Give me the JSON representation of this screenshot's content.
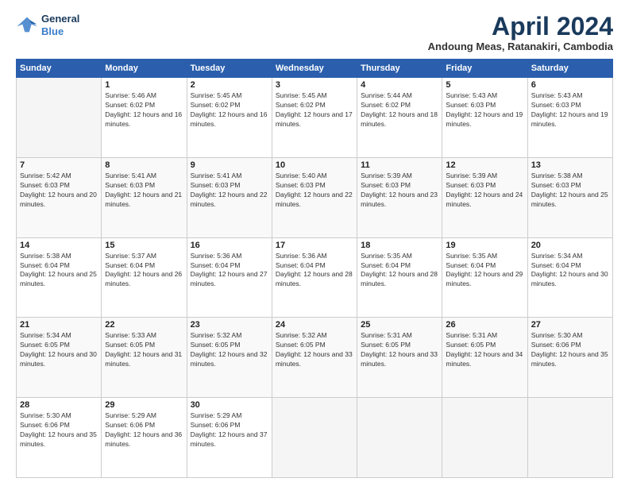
{
  "logo": {
    "line1": "General",
    "line2": "Blue"
  },
  "title": "April 2024",
  "subtitle": "Andoung Meas, Ratanakiri, Cambodia",
  "days_of_week": [
    "Sunday",
    "Monday",
    "Tuesday",
    "Wednesday",
    "Thursday",
    "Friday",
    "Saturday"
  ],
  "weeks": [
    [
      {
        "day": "",
        "sunrise": "",
        "sunset": "",
        "daylight": ""
      },
      {
        "day": "1",
        "sunrise": "Sunrise: 5:46 AM",
        "sunset": "Sunset: 6:02 PM",
        "daylight": "Daylight: 12 hours and 16 minutes."
      },
      {
        "day": "2",
        "sunrise": "Sunrise: 5:45 AM",
        "sunset": "Sunset: 6:02 PM",
        "daylight": "Daylight: 12 hours and 16 minutes."
      },
      {
        "day": "3",
        "sunrise": "Sunrise: 5:45 AM",
        "sunset": "Sunset: 6:02 PM",
        "daylight": "Daylight: 12 hours and 17 minutes."
      },
      {
        "day": "4",
        "sunrise": "Sunrise: 5:44 AM",
        "sunset": "Sunset: 6:02 PM",
        "daylight": "Daylight: 12 hours and 18 minutes."
      },
      {
        "day": "5",
        "sunrise": "Sunrise: 5:43 AM",
        "sunset": "Sunset: 6:03 PM",
        "daylight": "Daylight: 12 hours and 19 minutes."
      },
      {
        "day": "6",
        "sunrise": "Sunrise: 5:43 AM",
        "sunset": "Sunset: 6:03 PM",
        "daylight": "Daylight: 12 hours and 19 minutes."
      }
    ],
    [
      {
        "day": "7",
        "sunrise": "Sunrise: 5:42 AM",
        "sunset": "Sunset: 6:03 PM",
        "daylight": "Daylight: 12 hours and 20 minutes."
      },
      {
        "day": "8",
        "sunrise": "Sunrise: 5:41 AM",
        "sunset": "Sunset: 6:03 PM",
        "daylight": "Daylight: 12 hours and 21 minutes."
      },
      {
        "day": "9",
        "sunrise": "Sunrise: 5:41 AM",
        "sunset": "Sunset: 6:03 PM",
        "daylight": "Daylight: 12 hours and 22 minutes."
      },
      {
        "day": "10",
        "sunrise": "Sunrise: 5:40 AM",
        "sunset": "Sunset: 6:03 PM",
        "daylight": "Daylight: 12 hours and 22 minutes."
      },
      {
        "day": "11",
        "sunrise": "Sunrise: 5:39 AM",
        "sunset": "Sunset: 6:03 PM",
        "daylight": "Daylight: 12 hours and 23 minutes."
      },
      {
        "day": "12",
        "sunrise": "Sunrise: 5:39 AM",
        "sunset": "Sunset: 6:03 PM",
        "daylight": "Daylight: 12 hours and 24 minutes."
      },
      {
        "day": "13",
        "sunrise": "Sunrise: 5:38 AM",
        "sunset": "Sunset: 6:03 PM",
        "daylight": "Daylight: 12 hours and 25 minutes."
      }
    ],
    [
      {
        "day": "14",
        "sunrise": "Sunrise: 5:38 AM",
        "sunset": "Sunset: 6:04 PM",
        "daylight": "Daylight: 12 hours and 25 minutes."
      },
      {
        "day": "15",
        "sunrise": "Sunrise: 5:37 AM",
        "sunset": "Sunset: 6:04 PM",
        "daylight": "Daylight: 12 hours and 26 minutes."
      },
      {
        "day": "16",
        "sunrise": "Sunrise: 5:36 AM",
        "sunset": "Sunset: 6:04 PM",
        "daylight": "Daylight: 12 hours and 27 minutes."
      },
      {
        "day": "17",
        "sunrise": "Sunrise: 5:36 AM",
        "sunset": "Sunset: 6:04 PM",
        "daylight": "Daylight: 12 hours and 28 minutes."
      },
      {
        "day": "18",
        "sunrise": "Sunrise: 5:35 AM",
        "sunset": "Sunset: 6:04 PM",
        "daylight": "Daylight: 12 hours and 28 minutes."
      },
      {
        "day": "19",
        "sunrise": "Sunrise: 5:35 AM",
        "sunset": "Sunset: 6:04 PM",
        "daylight": "Daylight: 12 hours and 29 minutes."
      },
      {
        "day": "20",
        "sunrise": "Sunrise: 5:34 AM",
        "sunset": "Sunset: 6:04 PM",
        "daylight": "Daylight: 12 hours and 30 minutes."
      }
    ],
    [
      {
        "day": "21",
        "sunrise": "Sunrise: 5:34 AM",
        "sunset": "Sunset: 6:05 PM",
        "daylight": "Daylight: 12 hours and 30 minutes."
      },
      {
        "day": "22",
        "sunrise": "Sunrise: 5:33 AM",
        "sunset": "Sunset: 6:05 PM",
        "daylight": "Daylight: 12 hours and 31 minutes."
      },
      {
        "day": "23",
        "sunrise": "Sunrise: 5:32 AM",
        "sunset": "Sunset: 6:05 PM",
        "daylight": "Daylight: 12 hours and 32 minutes."
      },
      {
        "day": "24",
        "sunrise": "Sunrise: 5:32 AM",
        "sunset": "Sunset: 6:05 PM",
        "daylight": "Daylight: 12 hours and 33 minutes."
      },
      {
        "day": "25",
        "sunrise": "Sunrise: 5:31 AM",
        "sunset": "Sunset: 6:05 PM",
        "daylight": "Daylight: 12 hours and 33 minutes."
      },
      {
        "day": "26",
        "sunrise": "Sunrise: 5:31 AM",
        "sunset": "Sunset: 6:05 PM",
        "daylight": "Daylight: 12 hours and 34 minutes."
      },
      {
        "day": "27",
        "sunrise": "Sunrise: 5:30 AM",
        "sunset": "Sunset: 6:06 PM",
        "daylight": "Daylight: 12 hours and 35 minutes."
      }
    ],
    [
      {
        "day": "28",
        "sunrise": "Sunrise: 5:30 AM",
        "sunset": "Sunset: 6:06 PM",
        "daylight": "Daylight: 12 hours and 35 minutes."
      },
      {
        "day": "29",
        "sunrise": "Sunrise: 5:29 AM",
        "sunset": "Sunset: 6:06 PM",
        "daylight": "Daylight: 12 hours and 36 minutes."
      },
      {
        "day": "30",
        "sunrise": "Sunrise: 5:29 AM",
        "sunset": "Sunset: 6:06 PM",
        "daylight": "Daylight: 12 hours and 37 minutes."
      },
      {
        "day": "",
        "sunrise": "",
        "sunset": "",
        "daylight": ""
      },
      {
        "day": "",
        "sunrise": "",
        "sunset": "",
        "daylight": ""
      },
      {
        "day": "",
        "sunrise": "",
        "sunset": "",
        "daylight": ""
      },
      {
        "day": "",
        "sunrise": "",
        "sunset": "",
        "daylight": ""
      }
    ]
  ]
}
